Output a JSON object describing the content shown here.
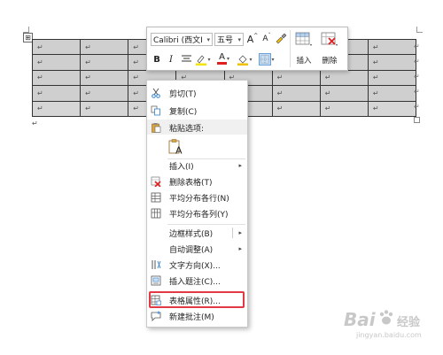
{
  "doc": {
    "para_mark": "↵",
    "anchor_glyph": "⊞",
    "rows": [
      [
        "↵",
        "↵",
        "↵",
        "↵",
        "↵",
        "↵",
        "↵",
        "↵"
      ],
      [
        "↵",
        "↵",
        "↵",
        "↵",
        "↵",
        "↵",
        "↵",
        "↵"
      ],
      [
        "↵",
        "↵",
        "↵",
        "↵",
        "↵",
        "↵",
        "↵",
        "↵"
      ],
      [
        "↵",
        "↵",
        "↵",
        "↵",
        "↵",
        "↵",
        "↵",
        "↵"
      ],
      [
        "↵",
        "↵",
        "↵",
        "↵",
        "↵",
        "↵",
        "↵",
        "↵"
      ]
    ]
  },
  "toolbar": {
    "font_name": "Calibri (西文I",
    "font_size": "五号",
    "grow_font": "A",
    "shrink_font": "A",
    "bold": "B",
    "italic": "I",
    "font_color": "A",
    "insert_label": "插入",
    "delete_label": "删除",
    "dropdown_arrow": "▾",
    "colors": {
      "highlight": "#f5e400",
      "font_color": "#e02020",
      "shading": "#f0c000",
      "accent": "#2f7fd0"
    }
  },
  "menu": {
    "cut": "剪切(T)",
    "copy": "复制(C)",
    "paste_options": "粘贴选项:",
    "insert": "插入(I)",
    "delete_table": "删除表格(T)",
    "distribute_rows": "平均分布各行(N)",
    "distribute_cols": "平均分布各列(Y)",
    "border_styles": "边框样式(B)",
    "autofit": "自动调整(A)",
    "text_direction": "文字方向(X)...",
    "insert_caption": "插入题注(C)...",
    "table_properties": "表格属性(R)...",
    "new_comment": "新建批注(M)",
    "submenu_arrow": "▸",
    "highlight_color": "#e23a44"
  },
  "watermark": {
    "brand": "Bai",
    "suffix": "经验",
    "url": "jingyan.baidu.com"
  }
}
